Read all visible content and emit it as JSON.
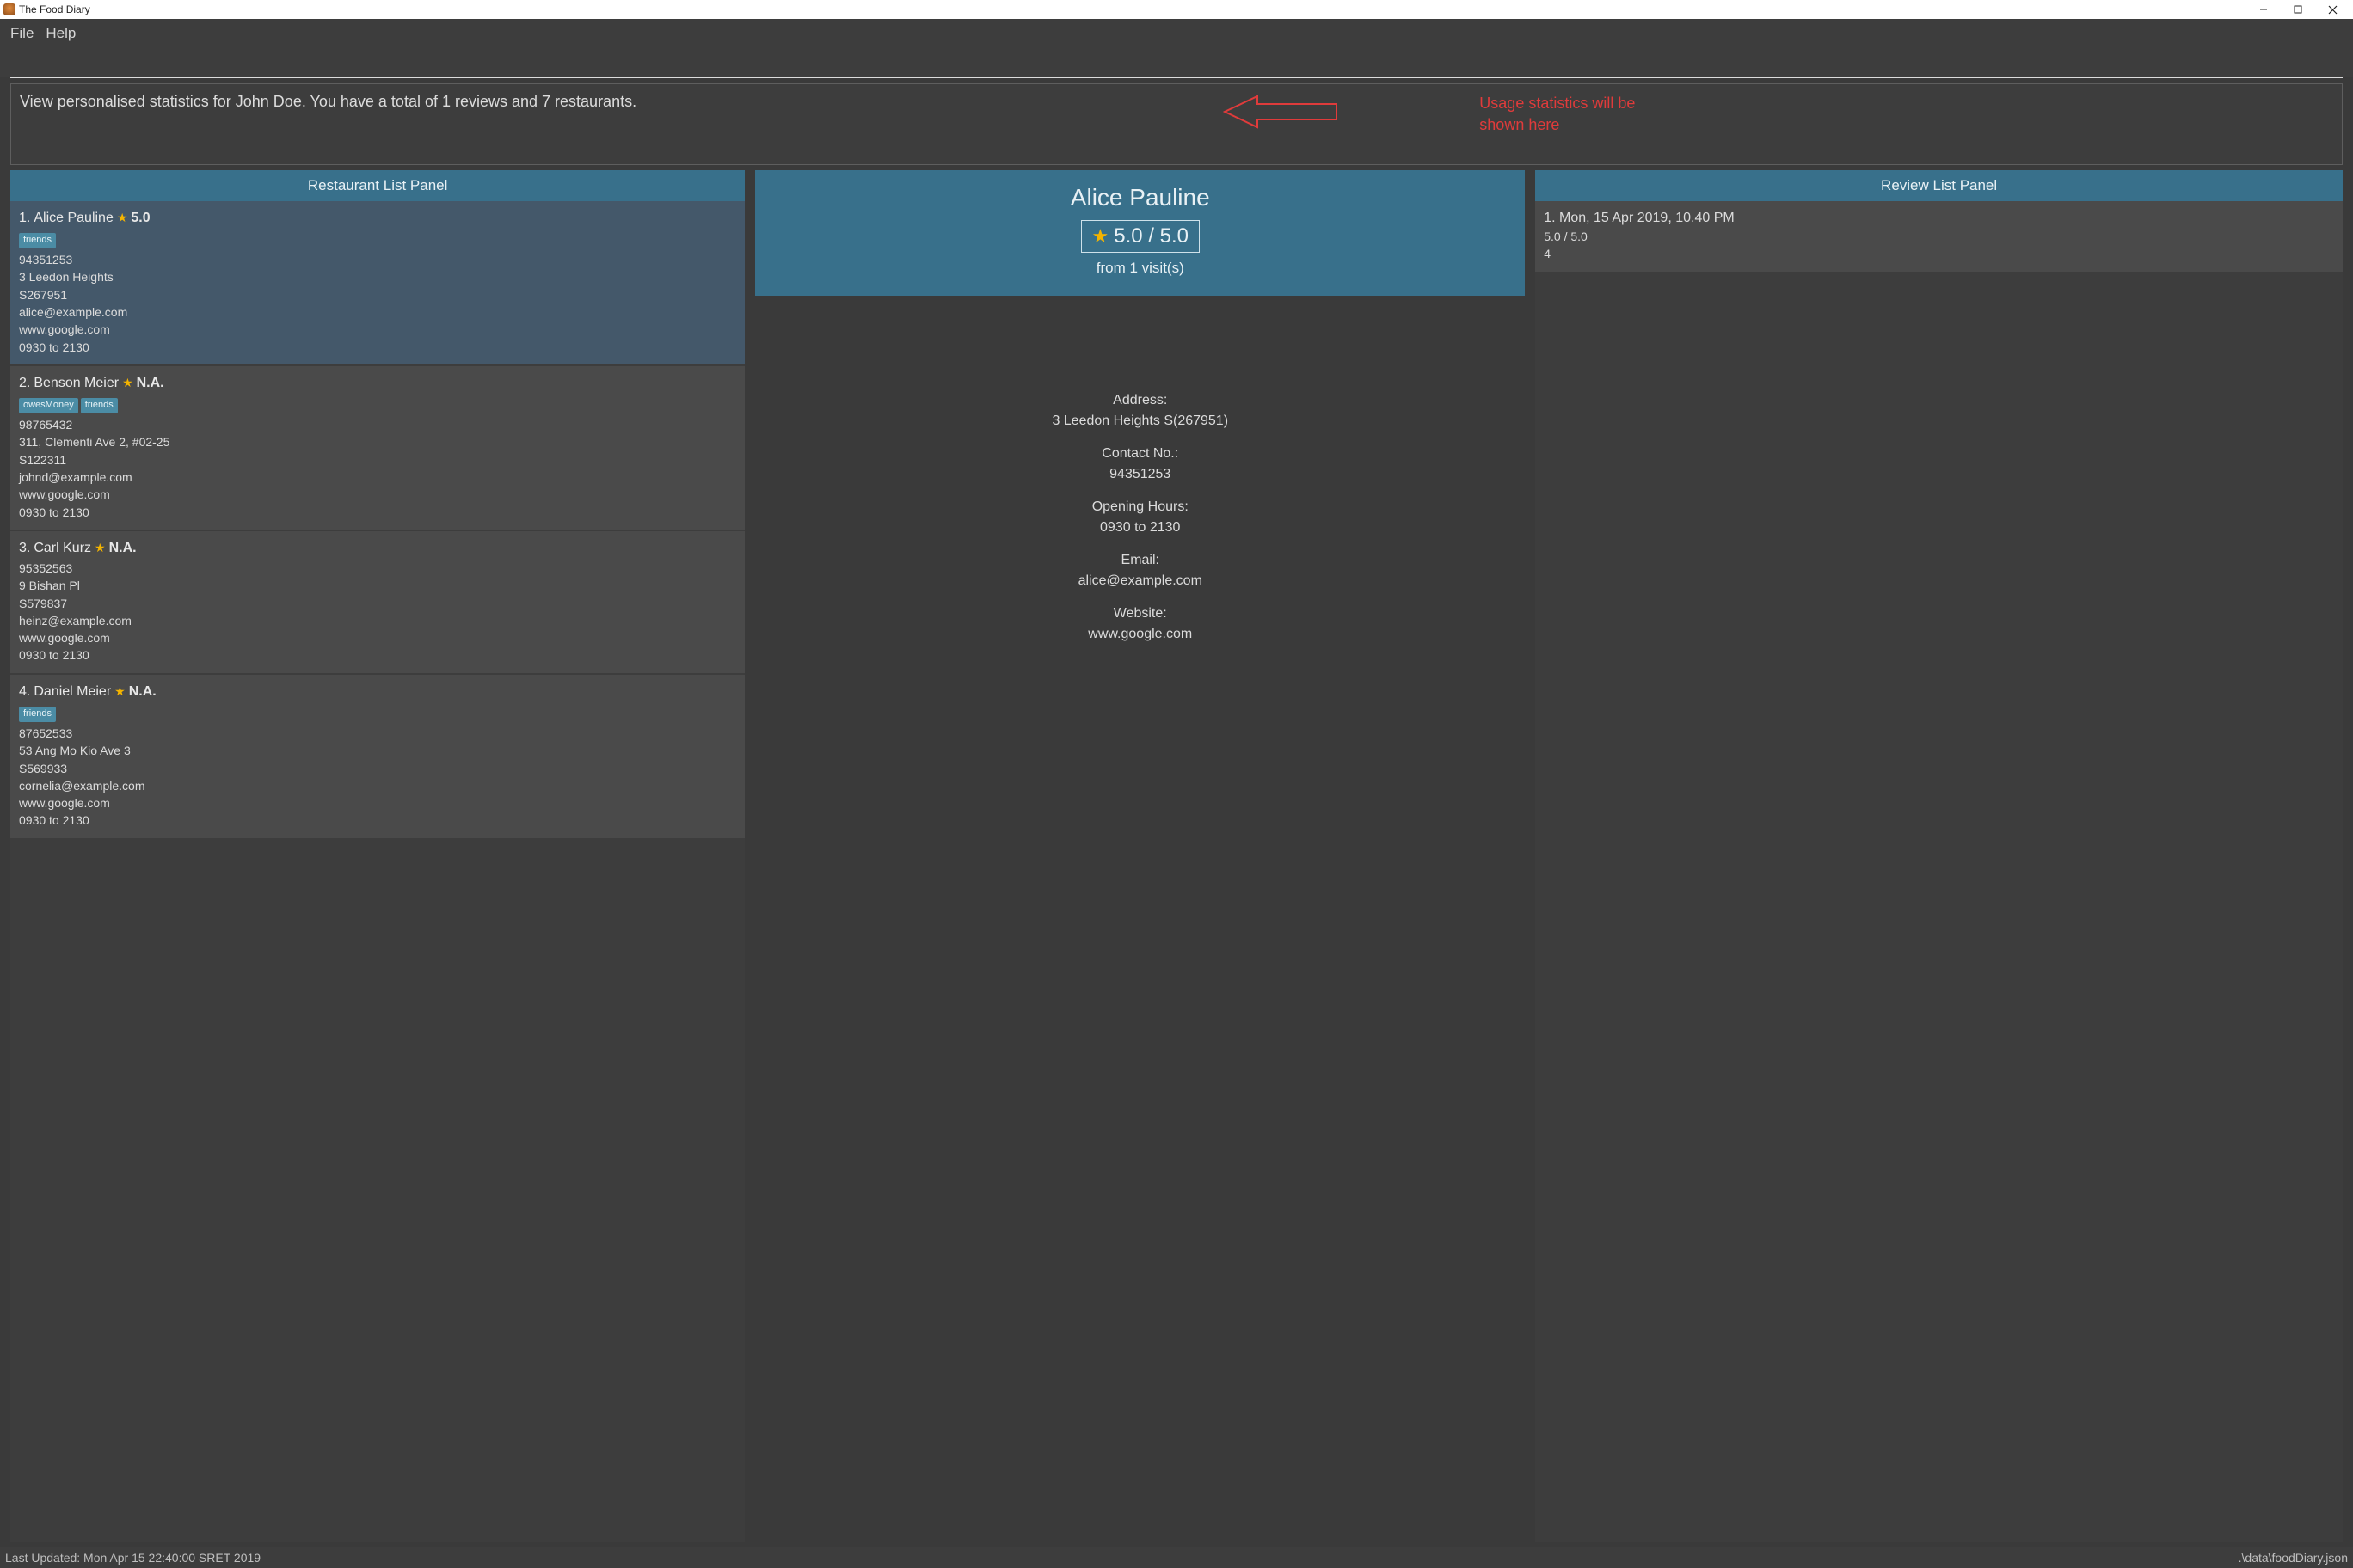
{
  "window": {
    "title": "The Food Diary"
  },
  "menu": {
    "items": [
      "File",
      "Help"
    ]
  },
  "stats_banner": {
    "text": "View personalised statistics for John Doe. You have a total of 1 reviews and 7 restaurants."
  },
  "annotation": {
    "text": "Usage statistics will be shown here"
  },
  "restaurant_panel": {
    "title": "Restaurant List Panel",
    "items": [
      {
        "index": "1.",
        "name": "Alice Pauline",
        "rating": "5.0",
        "tags": [
          "friends"
        ],
        "phone": "94351253",
        "address": "3 Leedon Heights",
        "postal": "S267951",
        "email": "alice@example.com",
        "website": "www.google.com",
        "hours": "0930 to 2130",
        "selected": true
      },
      {
        "index": "2.",
        "name": "Benson Meier",
        "rating": "N.A.",
        "tags": [
          "owesMoney",
          "friends"
        ],
        "phone": "98765432",
        "address": "311, Clementi Ave 2, #02-25",
        "postal": "S122311",
        "email": "johnd@example.com",
        "website": "www.google.com",
        "hours": "0930 to 2130",
        "selected": false
      },
      {
        "index": "3.",
        "name": "Carl Kurz",
        "rating": "N.A.",
        "tags": [],
        "phone": "95352563",
        "address": "9 Bishan Pl",
        "postal": "S579837",
        "email": "heinz@example.com",
        "website": "www.google.com",
        "hours": "0930 to 2130",
        "selected": false
      },
      {
        "index": "4.",
        "name": "Daniel Meier",
        "rating": "N.A.",
        "tags": [
          "friends"
        ],
        "phone": "87652533",
        "address": "53 Ang Mo Kio Ave 3",
        "postal": "S569933",
        "email": "cornelia@example.com",
        "website": "www.google.com",
        "hours": "0930 to 2130",
        "selected": false
      }
    ]
  },
  "detail": {
    "name": "Alice Pauline",
    "rating_display": "5.0 / 5.0",
    "visits": "from 1 visit(s)",
    "address_label": "Address:",
    "address_value": "3 Leedon Heights S(267951)",
    "contact_label": "Contact No.:",
    "contact_value": "94351253",
    "hours_label": "Opening Hours:",
    "hours_value": "0930 to 2130",
    "email_label": "Email:",
    "email_value": "alice@example.com",
    "website_label": "Website:",
    "website_value": "www.google.com"
  },
  "review_panel": {
    "title": "Review List Panel",
    "items": [
      {
        "index": "1.",
        "date": "Mon, 15 Apr 2019, 10.40 PM",
        "score": "5.0 / 5.0",
        "extra": "4"
      }
    ]
  },
  "statusbar": {
    "left": "Last Updated: Mon Apr 15 22:40:00 SRET 2019",
    "right": ".\\data\\foodDiary.json"
  }
}
